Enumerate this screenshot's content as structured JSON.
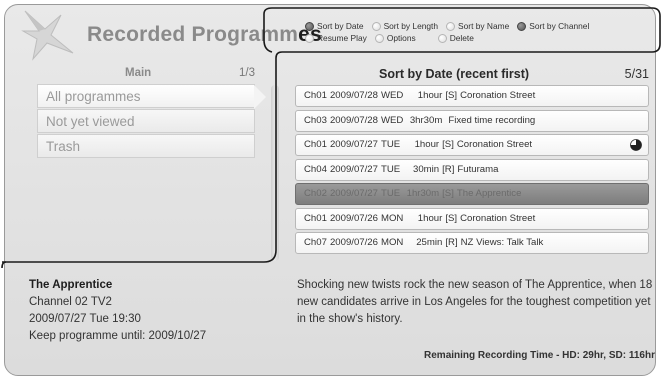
{
  "header": {
    "title_main": "Recorded Programm",
    "title_tail": "es"
  },
  "legend": [
    {
      "label": "Sort by Date",
      "state": "filled"
    },
    {
      "label": "Sort by Length",
      "state": "ghost"
    },
    {
      "label": "Sort by Name",
      "state": "ghost"
    },
    {
      "label": "Sort by Channel",
      "state": "filled"
    },
    {
      "label": "Resume Play",
      "state": "ghost"
    },
    {
      "label": "Options",
      "state": "ghost"
    },
    {
      "label": "Delete",
      "state": "ghost"
    }
  ],
  "menu": {
    "title": "Main",
    "counter": "1/3",
    "items": [
      {
        "label": "All programmes"
      },
      {
        "label": "Not yet viewed"
      },
      {
        "label": "Trash"
      }
    ]
  },
  "list": {
    "title": "Sort by Date (recent first)",
    "counter": "5/31",
    "programmes": [
      {
        "ch": "Ch01",
        "date": "2009/07/28",
        "day": "WED",
        "len": "1hour",
        "tag": "[S]",
        "name": "Coronation Street"
      },
      {
        "ch": "Ch03",
        "date": "2009/07/28",
        "day": "WED",
        "len": "3hr30m",
        "tag": "",
        "name": "Fixed time recording"
      },
      {
        "ch": "Ch01",
        "date": "2009/07/27",
        "day": "TUE",
        "len": "1hour",
        "tag": "[S]",
        "name": "Coronation Street",
        "partial": true
      },
      {
        "ch": "Ch04",
        "date": "2009/07/27",
        "day": "TUE",
        "len": "30min",
        "tag": "[R]",
        "name": "Futurama"
      },
      {
        "ch": "Ch02",
        "date": "2009/07/27",
        "day": "TUE",
        "len": "1hr30m",
        "tag": "[S]",
        "name": "The Apprentice",
        "selected": true
      },
      {
        "ch": "Ch01",
        "date": "2009/07/26",
        "day": "MON",
        "len": "1hour",
        "tag": "[S]",
        "name": "Coronation Street"
      },
      {
        "ch": "Ch07",
        "date": "2009/07/26",
        "day": "MON",
        "len": "25min",
        "tag": "[R]",
        "name": "NZ Views: Talk Talk"
      }
    ]
  },
  "detail": {
    "name": "The Apprentice",
    "channel": "Channel 02 TV2",
    "datetime": "2009/07/27 Tue 19:30",
    "keep": "Keep programme until: 2009/10/27",
    "description": "Shocking new twists rock the new season of The Apprentice, when 18 new candidates arrive in Los Angeles for the toughest competition yet in the show's history."
  },
  "footer": {
    "remaining": "Remaining Recording Time - HD: 29hr, SD: 116hr"
  }
}
